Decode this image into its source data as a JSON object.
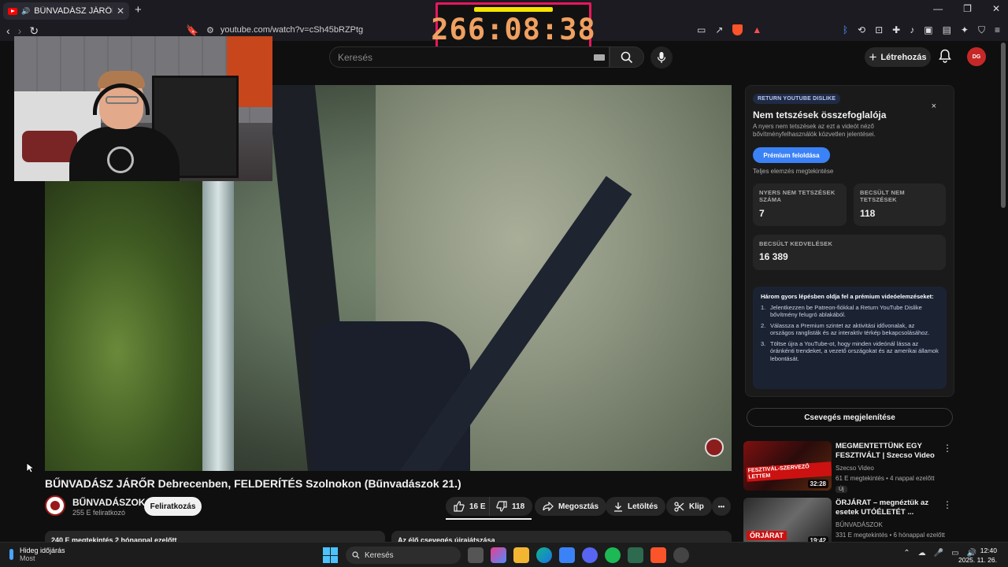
{
  "browser": {
    "tab_title": "BŰNVADÁSZ JÁRŐR Debrecen",
    "tab_close": "✕",
    "new_tab": "+",
    "url": "youtube.com/watch?v=cSh45bRZPtg",
    "window_controls": [
      "—",
      "❐",
      "✕"
    ]
  },
  "timer": {
    "text": "266:08:38"
  },
  "header": {
    "search_placeholder": "Keresés",
    "create_label": "Létrehozás",
    "create_plus": "+",
    "avatar_text": "DG"
  },
  "video": {
    "title": "BŰNVADÁSZ JÁRŐR Debrecenben, FELDERÍTÉS Szolnokon (Bűnvadászok 21.)",
    "channel_name": "BŰNVADÁSZOK",
    "channel_subs": "255 E feliratkozó",
    "subscribe_label": "Feliratkozás",
    "likes": "16 E",
    "dislikes": "118",
    "share_label": "Megosztás",
    "download_label": "Letöltés",
    "clip_label": "Klip",
    "more_label": "•••",
    "desc_left": "240 E megtekintés  2 hónappal ezelőtt",
    "desc_right": "Az élő csevegés újrajátszása"
  },
  "dislike_panel": {
    "tag": "RETURN YOUTUBE DISLIKE",
    "close": "×",
    "title": "Nem tetszések összefoglalója",
    "subtitle": "A nyers nem tetszések az ezt a videót néző bővítményfelhasználók közvetlen jelentései.",
    "premium_button": "Prémium feloldása",
    "full_analysis": "Teljes elemzés megtekintése",
    "stats": [
      {
        "label": "NYERS NEM TETSZÉSEK SZÁMA",
        "value": "7"
      },
      {
        "label": "BECSÜLT NEM TETSZÉSEK",
        "value": "118"
      },
      {
        "label": "BECSÜLT KEDVELÉSEK",
        "value": "16 389"
      }
    ],
    "steps_heading": "Három gyors lépésben oldja fel a prémium videóelemzéseket:",
    "steps": [
      {
        "n": "1.",
        "text": "Jelentkezzen be Patreon-fiókkal a Return YouTube Dislike bővítmény felugró ablakából."
      },
      {
        "n": "2.",
        "text": "Válassza a Premium szintet az aktivitási idővonalak, az országos ranglisták és az interaktív térkép bekapcsolásához."
      },
      {
        "n": "3.",
        "text": "Töltse újra a YouTube-ot, hogy minden videónál lássa az óránkénti trendeket, a vezető országokat és az amerikai államok lebontását."
      }
    ]
  },
  "chat_button": "Csevegés megjelenítése",
  "recommendations": [
    {
      "title": "MEGMENTETTÜNK EGY FESZTIVÁLT | Szecso Video",
      "channel": "Szecso Video",
      "meta": "61 E megtekintés • 4 nappal ezelőtt",
      "duration": "32:28",
      "thumb_text": "FESZTIVÁL-SZERVEZŐ LETTEM",
      "badge": "Új"
    },
    {
      "title": "ÖRJÁRAT – megnéztük az esetek UTÓÉLETÉT ...",
      "channel": "BŰNVADÁSZOK",
      "meta": "331 E megtekintés • 6 hónappal ezelőtt",
      "duration": "19:42",
      "thumb_text": "ŐRJÁRAT"
    }
  ],
  "taskbar": {
    "weather_title": "Hideg időjárás",
    "weather_sub": "Most",
    "search_label": "Keresés",
    "time": "12:40",
    "date": "2025. 11. 26."
  }
}
